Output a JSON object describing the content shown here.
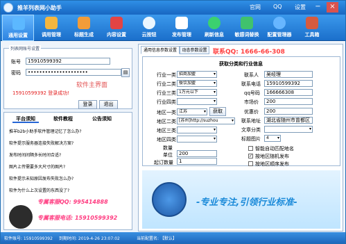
{
  "title": "推羊列表网小助手",
  "top_links": [
    "官网",
    "QQ",
    "设置"
  ],
  "toolbar": [
    {
      "label": "通用设置",
      "icon": "monitor-gear-icon",
      "active": true
    },
    {
      "label": "调用管理",
      "icon": "folder-icon"
    },
    {
      "label": "标题生成",
      "icon": "pencil-icon"
    },
    {
      "label": "内容设置",
      "icon": "book-icon"
    },
    {
      "label": "云按钮",
      "icon": "cloud-icon"
    },
    {
      "label": "发布管理",
      "icon": "document-icon"
    },
    {
      "label": "刷新信息",
      "icon": "refresh-icon"
    },
    {
      "label": "敏感词替换",
      "icon": "swap-icon"
    },
    {
      "label": "配置管理器",
      "icon": "globe-icon"
    },
    {
      "label": "工具箱",
      "icon": "toolbox-icon"
    }
  ],
  "account": {
    "group_label": "列表网账号设置",
    "account_label": "账号",
    "account_value": "15910599392",
    "password_label": "密码",
    "password_value": "•••••••••••••••••••••",
    "center_mark": "软件主界面",
    "status_msg": "15910599392 登录成功!",
    "login_label": "登录",
    "logout_label": "退出"
  },
  "news": {
    "tabs": [
      "平台须知",
      "软件教程",
      "公告须知"
    ],
    "items": [
      "推羊b2b小助手软件管理记忆了怎么办?",
      "软件提示服务器连接失败解决方案?",
      "发布时间间隔多长时间合适?",
      "图片上传需要多大尺寸的图片?",
      "软件提示未知原因发布失败怎么办?",
      "软件为什么上次设置的东西没了?"
    ],
    "qq_line": "专属客服QQ: 995414888",
    "phone_line": "专属客服电话: 15910599392"
  },
  "right": {
    "tabs": [
      "通用信息参数设置",
      "动态参数设置"
    ],
    "contact": "联系QQ: 1666-66-308",
    "fetch_title": "获取分类和行业信息",
    "industry_rows": [
      {
        "label": "行业一类",
        "value": "招商加盟"
      },
      {
        "label": "行业二类",
        "value": "餐饮加盟"
      },
      {
        "label": "行业三类",
        "value": "1万元以下"
      },
      {
        "label": "行业四类",
        "value": ""
      }
    ],
    "region_rows": [
      {
        "label": "地区一类",
        "value": "江苏"
      },
      {
        "label": "地区二类",
        "value": "[苏州]http://suzhou"
      },
      {
        "label": "地区三类",
        "value": ""
      },
      {
        "label": "地区四类",
        "value": ""
      }
    ],
    "fetch_label": "获取",
    "qty_label": "数量",
    "unit_label": "单位",
    "unit_value": "200",
    "start_label": "起订数量",
    "start_value": "1",
    "contact_rows": [
      {
        "label": "联系人",
        "value": "吴经理"
      },
      {
        "label": "联系电话",
        "value": "15910599392"
      },
      {
        "label": "qq号码",
        "value": "166666308"
      },
      {
        "label": "市场价",
        "value": "200"
      },
      {
        "label": "优惠价",
        "value": "200"
      },
      {
        "label": "联系地址",
        "value": "湖北省随州市曾都区"
      },
      {
        "label": "文章分类",
        "value": ""
      },
      {
        "label": "标题图片",
        "value": "4"
      }
    ],
    "checkboxes": [
      {
        "label": "智能自动匹配地名",
        "checked": false
      },
      {
        "label": "按地区随机发布",
        "checked": true
      },
      {
        "label": "按地区顺序发布",
        "checked": false
      }
    ],
    "slogan": "-专业专注,引领行业标准-"
  },
  "statusbar": {
    "account": "软件账号: 15910599392",
    "expire": "到期时间: 2019-4-26 23:07:02",
    "config": "当前配置名: 【默认】"
  },
  "colors": {
    "accent": "#1b6fcb",
    "warn": "#ff3b80"
  }
}
